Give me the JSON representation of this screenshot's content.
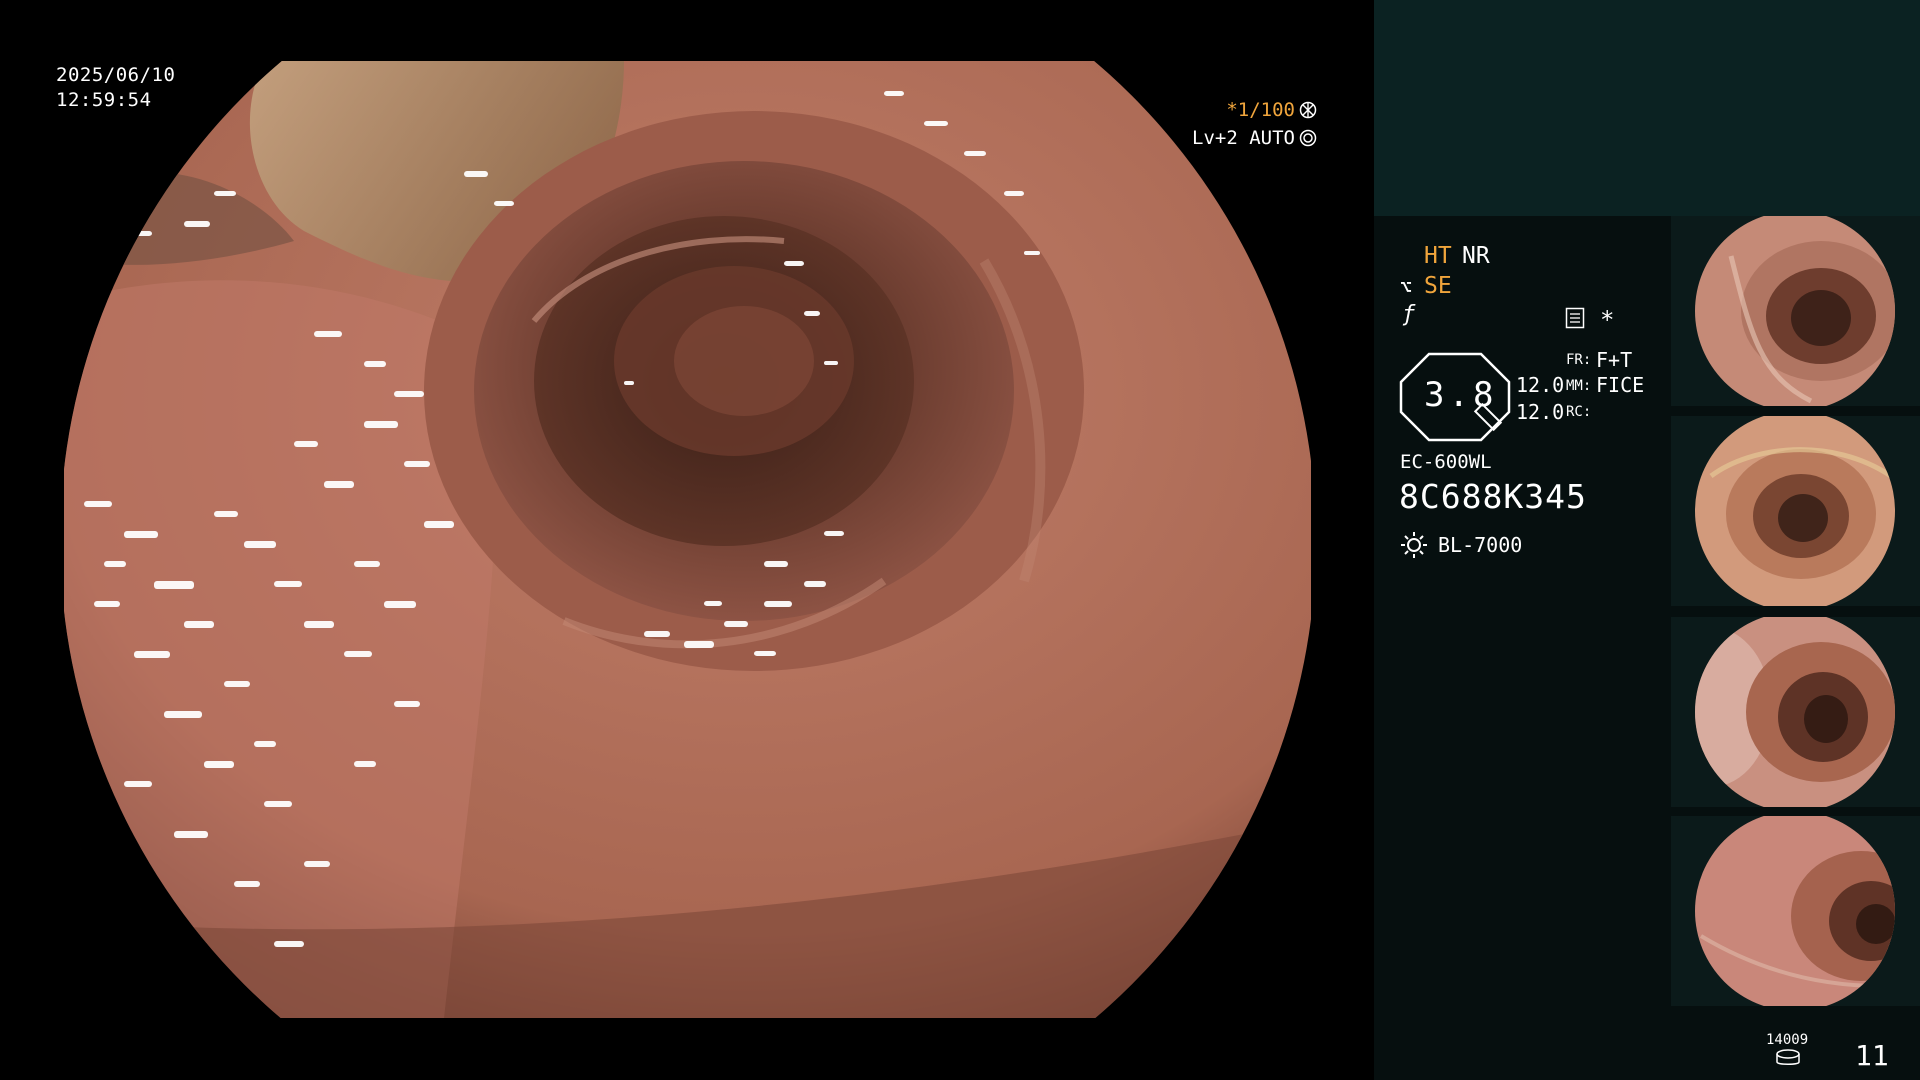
{
  "overlay": {
    "date": "2025/06/10",
    "time": "12:59:54",
    "shutter": "*1/100",
    "level": "Lv+2 AUTO"
  },
  "panel": {
    "ht": "HT",
    "nr": "NR",
    "se": "SE",
    "star": "*",
    "value_main": "3.8",
    "value_a": "12.0",
    "value_b": "12.0",
    "fr_label": "FR:",
    "fr_value": "F+T",
    "mm_label": "MM:",
    "mm_value": "FICE",
    "rc_label": "RC:",
    "scope_model": "EC-600WL",
    "serial": "8C688K345",
    "light_source": "BL-7000",
    "disk_count": "14009",
    "page": "11"
  },
  "thumbnails": [
    {
      "name": "thumbnail-1"
    },
    {
      "name": "thumbnail-2"
    },
    {
      "name": "thumbnail-3"
    },
    {
      "name": "thumbnail-4"
    }
  ],
  "colors": {
    "accent": "#f0a53c",
    "panel_top": "#0b2222",
    "panel_bottom": "#060f0f",
    "tissue": "#b3705c"
  },
  "icons": [
    "shutter-icon",
    "auto-icon",
    "se-icon",
    "enhance-icon",
    "document-icon",
    "star-icon",
    "brightness-octagon-icon",
    "sun-icon",
    "disk-icon"
  ]
}
